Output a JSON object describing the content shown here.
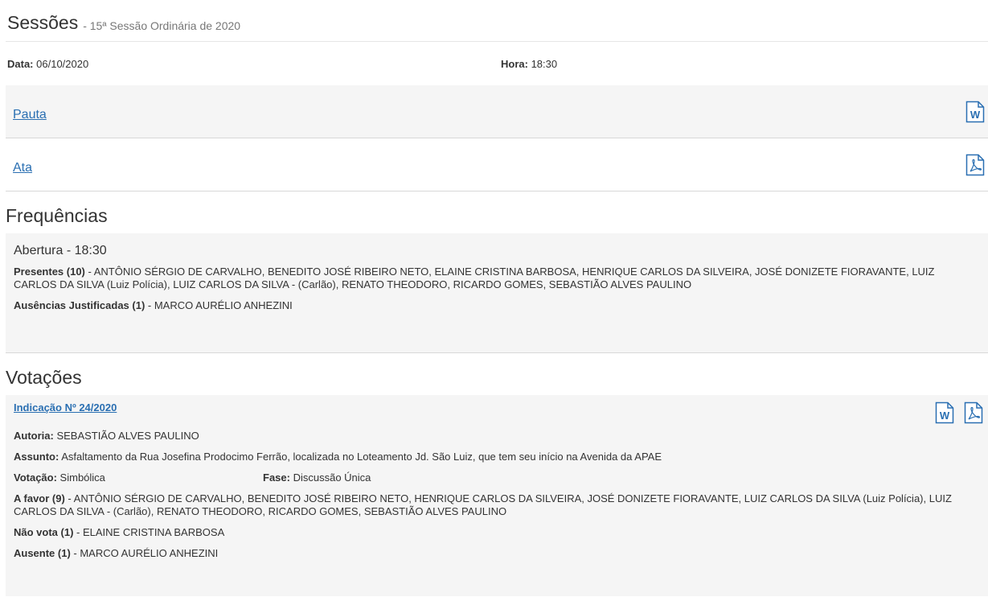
{
  "header": {
    "title": "Sessões",
    "subtitle": "- 15ª Sessão Ordinária de 2020"
  },
  "meta": {
    "data_label": "Data:",
    "data_value": "06/10/2020",
    "hora_label": "Hora:",
    "hora_value": "18:30"
  },
  "documents": {
    "pauta": "Pauta",
    "ata": "Ata",
    "word_icon": "word-icon",
    "pdf_icon": "pdf-icon"
  },
  "frequencias": {
    "title": "Frequências",
    "abertura": "Abertura - 18:30",
    "presentes_label": "Presentes (10)",
    "presentes_text": " - ANTÔNIO SÉRGIO DE CARVALHO, BENEDITO JOSÉ RIBEIRO NETO, ELAINE CRISTINA BARBOSA, HENRIQUE CARLOS DA SILVEIRA, JOSÉ DONIZETE FIORAVANTE, LUIZ CARLOS DA SILVA (Luiz Polícia), LUIZ CARLOS DA SILVA - (Carlão), RENATO THEODORO, RICARDO GOMES, SEBASTIÃO ALVES PAULINO",
    "ausencias_label": "Ausências Justificadas (1)",
    "ausencias_text": " - MARCO AURÉLIO ANHEZINI"
  },
  "votacoes": {
    "title": "Votações",
    "item": {
      "link": "Indicação Nº 24/2020",
      "autoria_label": "Autoria:",
      "autoria_value": " SEBASTIÃO ALVES PAULINO",
      "assunto_label": "Assunto:",
      "assunto_value": " Asfaltamento da Rua Josefina Prodocimo Ferrão, localizada no Loteamento Jd. São Luiz, que tem seu início na Avenida da APAE",
      "votacao_label": "Votação:",
      "votacao_value": " Simbólica",
      "fase_label": "Fase:",
      "fase_value": " Discussão Única",
      "afavor_label": "A favor (9)",
      "afavor_text": " - ANTÔNIO SÉRGIO DE CARVALHO, BENEDITO JOSÉ RIBEIRO NETO, HENRIQUE CARLOS DA SILVEIRA, JOSÉ DONIZETE FIORAVANTE, LUIZ CARLOS DA SILVA (Luiz Polícia), LUIZ CARLOS DA SILVA - (Carlão), RENATO THEODORO, RICARDO GOMES, SEBASTIÃO ALVES PAULINO",
      "naovota_label": "Não vota (1)",
      "naovota_text": " - ELAINE CRISTINA BARBOSA",
      "ausente_label": "Ausente (1)",
      "ausente_text": " - MARCO AURÉLIO ANHEZINI"
    }
  },
  "colors": {
    "link": "#2a6fb2",
    "panel": "#f5f5f5"
  }
}
